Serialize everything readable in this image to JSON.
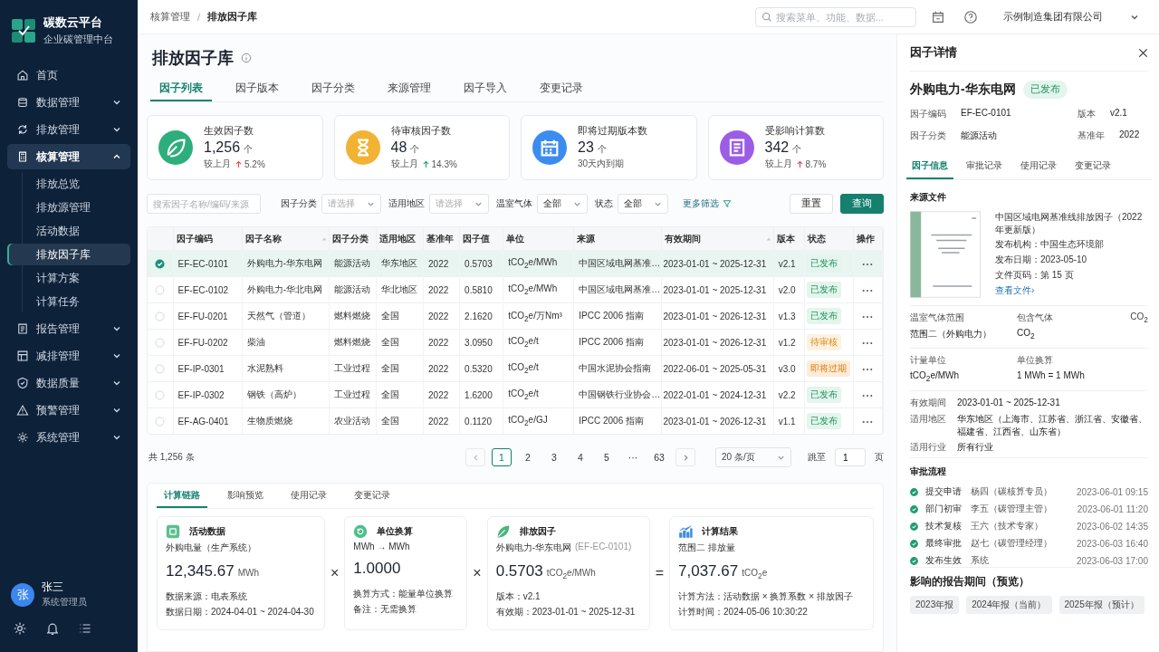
{
  "sidebar": {
    "logo": {
      "title": "碳数云平台",
      "subtitle": "企业碳管理中台"
    },
    "items": [
      {
        "label": "首页",
        "kind": "link"
      },
      {
        "label": "数据管理",
        "kind": "group",
        "expanded": false
      },
      {
        "label": "排放管理",
        "kind": "group",
        "expanded": false
      },
      {
        "label": "核算管理",
        "kind": "group",
        "expanded": true,
        "children": [
          {
            "label": "排放总览",
            "selected": false
          },
          {
            "label": "排放源管理",
            "selected": false
          },
          {
            "label": "活动数据",
            "selected": false
          },
          {
            "label": "排放因子库",
            "selected": true
          },
          {
            "label": "计算方案",
            "selected": false
          },
          {
            "label": "计算任务",
            "selected": false
          }
        ]
      },
      {
        "label": "报告管理",
        "kind": "group",
        "expanded": false
      },
      {
        "label": "减排管理",
        "kind": "group",
        "expanded": false
      },
      {
        "label": "数据质量",
        "kind": "group",
        "expanded": false
      },
      {
        "label": "预警管理",
        "kind": "group",
        "expanded": false
      },
      {
        "label": "系统管理",
        "kind": "group",
        "expanded": false
      }
    ],
    "user": {
      "avatar": "张",
      "name": "张三",
      "role": "系统管理员"
    }
  },
  "topbar": {
    "breadcrumb": [
      "核算管理",
      "排放因子库"
    ],
    "separator": "/",
    "search": {
      "placeholder": "搜索菜单、功能、数据..."
    },
    "company": "示例制造集团有限公司"
  },
  "page": {
    "title": "排放因子库",
    "tabs": [
      {
        "label": "因子列表",
        "selected": true
      },
      {
        "label": "因子版本",
        "selected": false
      },
      {
        "label": "因子分类",
        "selected": false
      },
      {
        "label": "来源管理",
        "selected": false
      },
      {
        "label": "因子导入",
        "selected": false
      },
      {
        "label": "变更记录",
        "selected": false
      }
    ],
    "stats": [
      {
        "label": "生效因子数",
        "value": "1,256",
        "unit": "个",
        "color": "#2eae7c",
        "compare": "较上月",
        "change": "5.2%",
        "trend": {
          "color": "#e5484d"
        }
      },
      {
        "label": "待审核因子数",
        "value": "48",
        "unit": "个",
        "color": "#f2b233",
        "compare": "较上月",
        "change": "14.3%",
        "trend": {
          "color": "#21a366"
        }
      },
      {
        "label": "即将过期版本数",
        "value": "23",
        "unit": "个",
        "color": "#3b8cf0",
        "note": "30天内到期"
      },
      {
        "label": "受影响计算数",
        "value": "342",
        "unit": "个",
        "color": "#9b5de5",
        "compare": "较上月",
        "change": "8.7%",
        "trend": {
          "color": "#e5484d"
        }
      }
    ],
    "filters": {
      "search": {
        "placeholder": "搜索因子名称/编码/来源"
      },
      "selects": [
        {
          "label": "因子分类",
          "placeholder": "请选择"
        },
        {
          "label": "适用地区",
          "placeholder": "请选择"
        },
        {
          "label": "温室气体",
          "value": "全部"
        },
        {
          "label": "状态",
          "value": "全部"
        }
      ],
      "more": "更多筛选",
      "reset": "重置",
      "query": "查询"
    },
    "table": {
      "columns": [
        {
          "label": "因子编码",
          "sortable": false
        },
        {
          "label": "因子名称",
          "sortable": true
        },
        {
          "label": "因子分类",
          "sortable": false
        },
        {
          "label": "适用地区",
          "sortable": false
        },
        {
          "label": "基准年",
          "sortable": false
        },
        {
          "label": "因子值",
          "sortable": false
        },
        {
          "label": "单位",
          "sortable": false
        },
        {
          "label": "来源",
          "sortable": false
        },
        {
          "label": "有效期间",
          "sortable": true
        },
        {
          "label": "版本",
          "sortable": false
        },
        {
          "label": "状态",
          "sortable": false
        },
        {
          "label": "操作",
          "sortable": false
        }
      ],
      "rows": [
        {
          "selected": true,
          "cells": [
            "EF-EC-0101",
            "外购电力-华东电网",
            "能源活动",
            "华东地区",
            "2022",
            "0.5703",
            "tCO$_{2}$e/MWh",
            "中国区域电网基准…",
            "2023-01-01 ~ 2025-12-31",
            "v2.1"
          ],
          "status": {
            "label": "已发布",
            "kind": "published"
          }
        },
        {
          "selected": false,
          "cells": [
            "EF-EC-0102",
            "外购电力-华北电网",
            "能源活动",
            "华北地区",
            "2022",
            "0.5810",
            "tCO$_{2}$e/MWh",
            "中国区域电网基准…",
            "2023-01-01 ~ 2025-12-31",
            "v2.0"
          ],
          "status": {
            "label": "已发布",
            "kind": "published"
          }
        },
        {
          "selected": false,
          "cells": [
            "EF-FU-0201",
            "天然气（管道）",
            "燃料燃烧",
            "全国",
            "2022",
            "2.1620",
            "tCO$_{2}$e/万Nm³",
            "IPCC 2006 指南",
            "2023-01-01 ~ 2026-12-31",
            "v1.3"
          ],
          "status": {
            "label": "已发布",
            "kind": "published"
          }
        },
        {
          "selected": false,
          "cells": [
            "EF-FU-0202",
            "柴油",
            "燃料燃烧",
            "全国",
            "2022",
            "3.0950",
            "tCO$_{2}$e/t",
            "IPCC 2006 指南",
            "2023-01-01 ~ 2026-12-31",
            "v1.2"
          ],
          "status": {
            "label": "待审核",
            "kind": "pending"
          }
        },
        {
          "selected": false,
          "cells": [
            "EF-IP-0301",
            "水泥熟料",
            "工业过程",
            "全国",
            "2022",
            "0.5320",
            "tCO$_{2}$e/t",
            "中国水泥协会指南",
            "2022-06-01 ~ 2025-05-31",
            "v3.0"
          ],
          "status": {
            "label": "即将过期",
            "kind": "expiring"
          }
        },
        {
          "selected": false,
          "cells": [
            "EF-IP-0302",
            "钢铁（高炉）",
            "工业过程",
            "全国",
            "2022",
            "1.6200",
            "tCO$_{2}$e/t",
            "中国钢铁行业协会…",
            "2022-01-01 ~ 2024-12-31",
            "v2.2"
          ],
          "status": {
            "label": "已发布",
            "kind": "published"
          }
        },
        {
          "selected": false,
          "cells": [
            "EF-AG-0401",
            "生物质燃烧",
            "农业活动",
            "全国",
            "2022",
            "0.1120",
            "tCO$_{2}$e/GJ",
            "IPCC 2006 指南",
            "2023-01-01 ~ 2026-12-31",
            "v1.1"
          ],
          "status": {
            "label": "已发布",
            "kind": "published"
          }
        }
      ]
    },
    "pagination": {
      "total": "共 1,256 条",
      "pages": [
        {
          "label": "1",
          "selected": true
        },
        {
          "label": "2",
          "selected": false
        },
        {
          "label": "3",
          "selected": false
        },
        {
          "label": "4",
          "selected": false
        },
        {
          "label": "5",
          "selected": false
        },
        {
          "label": "···",
          "selected": false
        },
        {
          "label": "63",
          "selected": false
        }
      ],
      "page_size": "20 条/页",
      "jump_label": "跳至",
      "jump_value": "1",
      "jump_suffix": "页"
    },
    "chain": {
      "tabs": [
        {
          "label": "计算链路",
          "selected": true
        },
        {
          "label": "影响预览",
          "selected": false
        },
        {
          "label": "使用记录",
          "selected": false
        },
        {
          "label": "变更记录",
          "selected": false
        }
      ],
      "cards": [
        {
          "title": "活动数据",
          "subtitle": "外购电量（生产系统）",
          "value": "12,345.67",
          "unit": "MWh",
          "lines": [
            "数据来源：电表系统",
            "数据日期：2024-04-01 ~ 2024-04-30"
          ]
        },
        {
          "title": "单位换算",
          "subtitle": "MWh → MWh",
          "value": "1.0000",
          "lines": [
            "换算方式：能量单位换算",
            "备注：无需换算"
          ]
        },
        {
          "title": "排放因子",
          "subtitle": "外购电力-华东电网",
          "subtitle_note": "(EF-EC-0101)",
          "value": "0.5703",
          "unit": "tCO$_{2}$e/MWh",
          "lines": [
            "版本：v2.1",
            "有效期：2023-01-01 ~ 2025-12-31"
          ]
        },
        {
          "title": "计算结果",
          "subtitle": "范围二 排放量",
          "value": "7,037.67",
          "unit": "tCO$_{2}$e",
          "lines": [
            "计算方法：活动数据 × 换算系数 × 排放因子",
            "计算时间：2024-05-06 10:30:22"
          ]
        }
      ],
      "operators": [
        "×",
        "×",
        "="
      ]
    }
  },
  "detail": {
    "title": "因子详情",
    "name": "外购电力-华东电网",
    "status": {
      "label": "已发布",
      "kind": "published"
    },
    "meta": [
      {
        "label": "因子编码",
        "value": "EF-EC-0101"
      },
      {
        "label": "版本",
        "value": "v2.1"
      },
      {
        "label": "因子分类",
        "value": "能源活动"
      },
      {
        "label": "基准年",
        "value": "2022"
      }
    ],
    "tabs": [
      {
        "label": "因子信息",
        "selected": true
      },
      {
        "label": "审批记录",
        "selected": false
      },
      {
        "label": "使用记录",
        "selected": false
      },
      {
        "label": "变更记录",
        "selected": false
      }
    ],
    "source": {
      "heading": "来源文件",
      "title": "中国区域电网基准线排放因子（2022年更新版）",
      "lines": [
        "发布机构：中国生态环境部",
        "发布日期：2023-05-10",
        "文件页码：第 15 页"
      ],
      "link": "查看文件›"
    },
    "gas": {
      "scope_label": "温室气体范围",
      "scope": "范围二（外购电力）",
      "gas_label": "包含气体",
      "gas": "CO$_{2}$",
      "corner": "CO$_{2}$"
    },
    "unit": {
      "label": "计量单位",
      "value": "tCO$_{2}$e/MWh",
      "conv_label": "单位换算",
      "conv": "1 MWh = 1 MWh"
    },
    "info": [
      {
        "label": "有效期间",
        "value": "2023-01-01 ~ 2025-12-31"
      },
      {
        "label": "适用地区",
        "value": "华东地区（上海市、江苏省、浙江省、安徽省、福建省、江西省、山东省）"
      },
      {
        "label": "适用行业",
        "value": "所有行业"
      }
    ],
    "approval": {
      "heading": "审批流程",
      "steps": [
        {
          "step": "提交申请",
          "person": "杨四（碳核算专员）",
          "time": "2023-06-01 09:15",
          "done": true
        },
        {
          "step": "部门初审",
          "person": "李五（碳管理主管）",
          "time": "2023-06-01 11:20",
          "done": true
        },
        {
          "step": "技术复核",
          "person": "王六（技术专家）",
          "time": "2023-06-02 14:35",
          "done": true
        },
        {
          "step": "最终审批",
          "person": "赵七（碳管理经理）",
          "time": "2023-06-03 16:40",
          "done": true
        },
        {
          "step": "发布生效",
          "person": "系统",
          "time": "2023-06-03 17:00",
          "done": true
        }
      ]
    },
    "reports": {
      "heading": "影响的报告期间（预览）",
      "tags": [
        "2023年报",
        "2024年报（当前）",
        "2025年报（预计）"
      ]
    }
  }
}
